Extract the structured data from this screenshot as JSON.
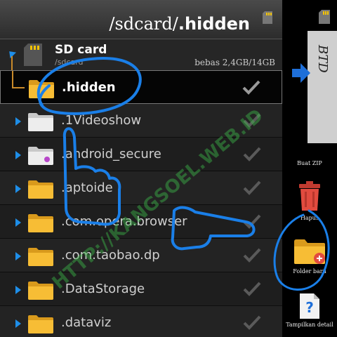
{
  "header": {
    "path_prefix": "/sdcard/",
    "path_current": ".hidden"
  },
  "sdcard": {
    "title": "SD card",
    "subtitle": "/sdcard",
    "space": "bebas 2,4GB/14GB"
  },
  "folders": [
    {
      "name": ".hidden",
      "selected": true
    },
    {
      "name": ".1Videoshow"
    },
    {
      "name": ".android_secure"
    },
    {
      "name": ".aptoide"
    },
    {
      "name": ".com.opera.browser"
    },
    {
      "name": ".com.taobao.dp"
    },
    {
      "name": ".DataStorage"
    },
    {
      "name": ".dataviz"
    }
  ],
  "right_panel": {
    "card_label": "BTD",
    "buttons": {
      "zip": "Buat ZIP",
      "hapus": "Hapus",
      "folder_baru": "Folder baru",
      "detail": "Tampilkan detail"
    }
  },
  "watermark": "HTTP://KANGSOEL.WEB.ID",
  "colors": {
    "accent_blue": "#1e8ee8",
    "folder_yellow": "#f5b52a",
    "delete_red": "#e24b3f",
    "annotation_blue": "#1a7fe8",
    "watermark_green": "#3cb84a"
  }
}
